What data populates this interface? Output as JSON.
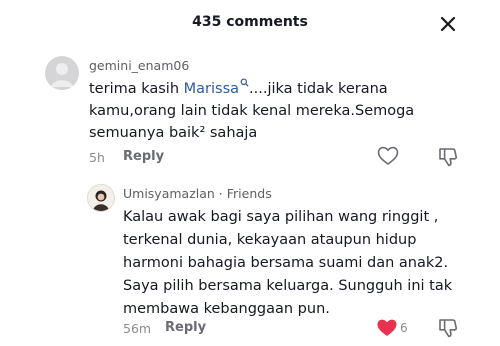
{
  "header": {
    "title": "435 comments",
    "close_icon": "close-icon"
  },
  "comments": [
    {
      "username": "gemini_enam06",
      "avatar_icon": "default-avatar-icon",
      "mention": "Marissa",
      "mention_icon": "search-icon",
      "line1_rest": "....jika tidak kerana",
      "line1_prefix": "terima kasih ",
      "line2": "kamu,orang lain tidak kenal mereka.Semoga",
      "line3": "semuanya baik² sahaja",
      "time": "5h",
      "reply_label": "Reply"
    }
  ],
  "reply": {
    "username": "Umisyamazlan",
    "relation": " · Friends",
    "avatar_icon": "user-avatar-icon",
    "lines": [
      "Kalau awak bagi saya pilihan wang ringgit ,",
      "terkenal dunia, kekayaan ataupun hidup",
      "harmoni bahagia bersama suami dan anak2.",
      "Saya pilih bersama keluarga. Sungguh ini tak",
      "membawa kebanggaan pun."
    ],
    "time": "56m",
    "reply_label": "Reply",
    "like_count": "6",
    "like_color": "#fe2c55"
  }
}
